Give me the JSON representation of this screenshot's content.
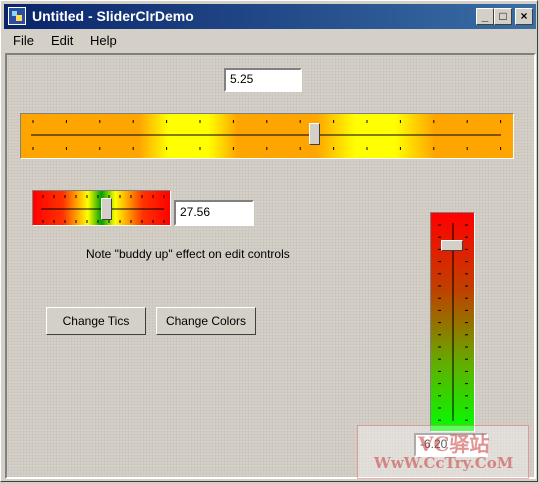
{
  "window": {
    "title": "Untitled - SliderClrDemo"
  },
  "titlebar_buttons": {
    "minimize": "_",
    "maximize": "□",
    "close": "×"
  },
  "menu": {
    "file": "File",
    "edit": "Edit",
    "help": "Help"
  },
  "top_slider": {
    "value_text": "5.25",
    "colors": [
      "#ffa500",
      "#ffff00"
    ]
  },
  "small_slider": {
    "value_text": "27.56",
    "colors": [
      "#ff0000",
      "#ffff00",
      "#00a000"
    ]
  },
  "vertical_slider": {
    "value_text": "-6.20",
    "colors": [
      "#ff0000",
      "#00ff00"
    ]
  },
  "note": "Note \"buddy up\" effect on edit controls",
  "buttons": {
    "change_tics": "Change Tics",
    "change_colors": "Change Colors"
  },
  "watermark": {
    "line1": "VC驿站",
    "line2": "WwW.CcTry.CoM"
  }
}
